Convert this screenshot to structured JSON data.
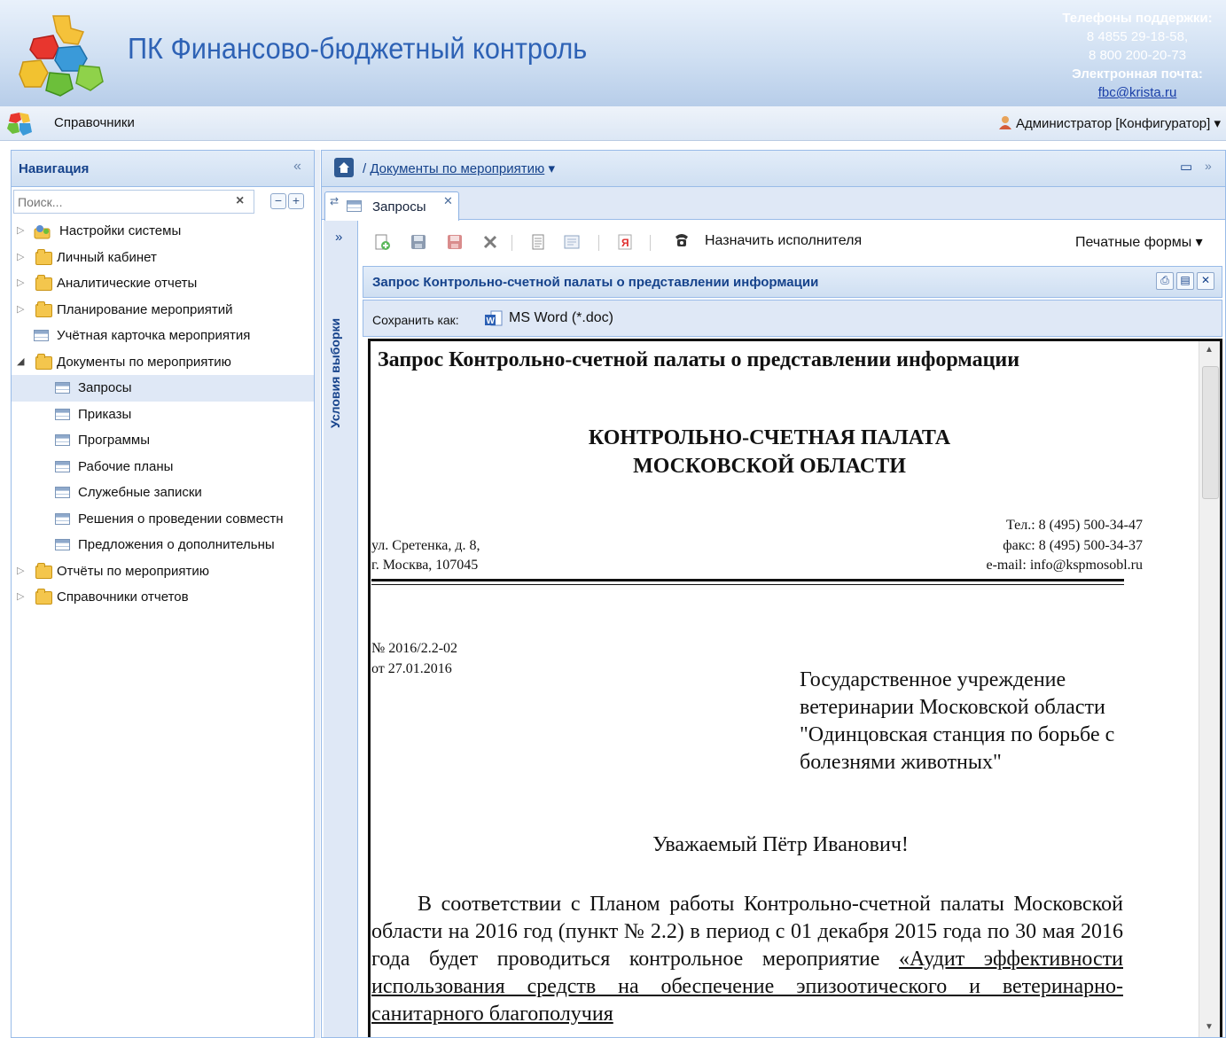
{
  "header": {
    "app_title": "ПК Финансово-бюджетный контроль",
    "support_title": "Телефоны поддержки:",
    "phone1": "8 4855 29-18-58,",
    "phone2": "8 800 200-20-73",
    "email_title": "Электронная почта:",
    "email": "fbc@krista.ru"
  },
  "menubar": {
    "references": "Справочники",
    "user": "Администратор [Конфигуратор]"
  },
  "nav": {
    "title": "Навигация",
    "search_placeholder": "Поиск...",
    "items": [
      {
        "label": "Настройки системы"
      },
      {
        "label": "Личный кабинет"
      },
      {
        "label": "Аналитические отчеты"
      },
      {
        "label": "Планирование мероприятий"
      },
      {
        "label": "Учётная карточка мероприятия"
      },
      {
        "label": "Документы по мероприятию"
      },
      {
        "label": "Запросы"
      },
      {
        "label": "Приказы"
      },
      {
        "label": "Программы"
      },
      {
        "label": "Рабочие планы"
      },
      {
        "label": "Служебные записки"
      },
      {
        "label": "Решения о проведении совместн"
      },
      {
        "label": "Предложения о дополнительны"
      },
      {
        "label": "Отчёты по мероприятию"
      },
      {
        "label": "Справочники отчетов"
      }
    ]
  },
  "main": {
    "breadcrumb": "Документы по мероприятию",
    "tab_label": "Запросы",
    "side_label": "Условия выборки",
    "assign_label": "Назначить исполнителя",
    "print_forms": "Печатные формы",
    "report_title": "Запрос Контрольно-счетной палаты о представлении информации",
    "save_as": "Сохранить как:",
    "save_format": "MS Word (*.doc)"
  },
  "document": {
    "title": "Запрос Контрольно-счетной палаты о представлении информации",
    "org_line1": "КОНТРОЛЬНО-СЧЕТНАЯ  ПАЛАТА",
    "org_line2": "МОСКОВСКОЙ  ОБЛАСТИ",
    "address1": "ул. Сретенка, д. 8,",
    "address2": "г. Москва, 107045",
    "tel": "Тел.: 8 (495) 500-34-47",
    "fax": "факс: 8 (495) 500-34-37",
    "email": "e-mail: info@kspmosobl.ru",
    "number": "№ 2016/2.2-02",
    "date": "от 27.01.2016",
    "addressee": "Государственное учреждение ветеринарии Московской области \"Одинцовская станция по борьбе с болезнями животных\"",
    "greeting": "Уважаемый Пётр Иванович!",
    "body_plain": "В соответствии с Планом работы Контрольно-счетной палаты Московской области на 2016 год (пункт № 2.2) в период с 01 декабря 2015 года по 30 мая 2016 года будет проводиться контрольное мероприятие ",
    "body_underlined": "«Аудит эффективности использования средств на обеспечение эпизоотического и ветеринарно-санитарного благополучия"
  },
  "colors": {
    "accent": "#15428b",
    "panel_bg": "#dfe8f6",
    "border": "#99bbe8",
    "selected_row": "#dfe8f6"
  }
}
